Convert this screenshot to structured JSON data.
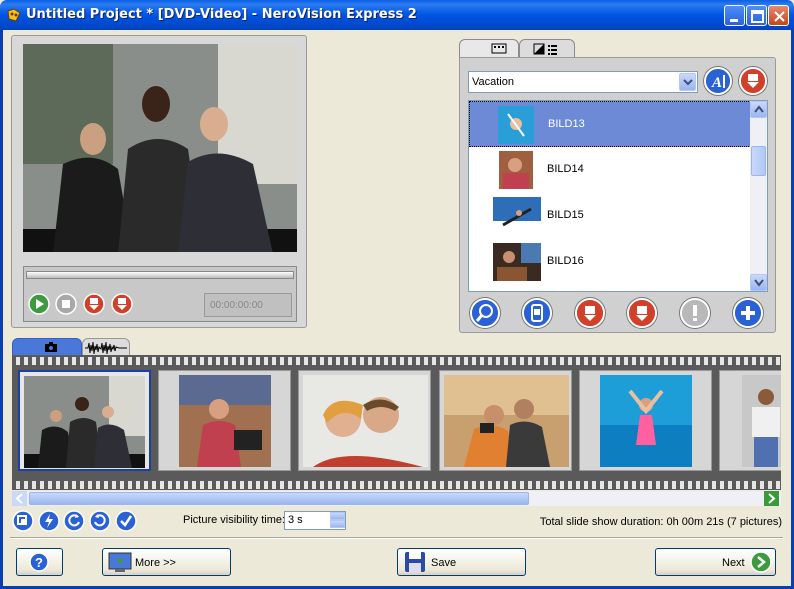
{
  "window": {
    "title": "Untitled Project * [DVD-Video] - NeroVision Express 2"
  },
  "preview": {
    "timecode": "00:00:00:00"
  },
  "browser": {
    "folder_selected": "Vacation",
    "items": [
      {
        "label": "BILD13",
        "selected": true
      },
      {
        "label": "BILD14",
        "selected": false
      },
      {
        "label": "BILD15",
        "selected": false
      },
      {
        "label": "BILD16",
        "selected": false
      }
    ]
  },
  "slideshow": {
    "visibility_label": "Picture visibility time:",
    "visibility_value": "3 s",
    "duration_text": "Total slide show duration: 0h 00m 21s (7 pictures)"
  },
  "footer": {
    "more_label": "More >>",
    "save_label": "Save",
    "next_label": "Next"
  },
  "colors": {
    "titlebar": "#0054e3",
    "selection": "#6c8ad6",
    "window_bg": "#ece9d8"
  }
}
